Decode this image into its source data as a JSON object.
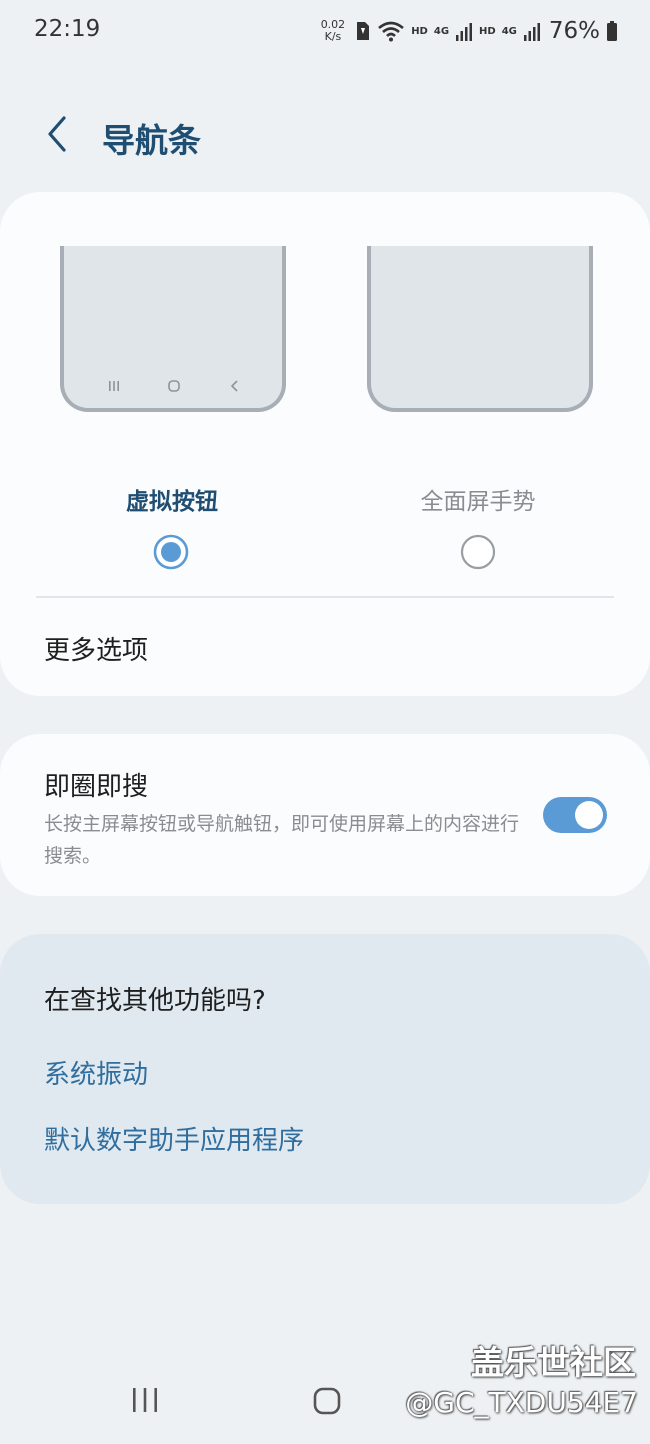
{
  "status_bar": {
    "time": "22:19",
    "speed_value": "0.02",
    "speed_unit": "K/s",
    "hd_1": "HD",
    "net_1": "4G",
    "hd_2": "HD",
    "net_2": "4G",
    "battery": "76%",
    "icons": [
      "sim-icon",
      "wifi-icon",
      "signal-icon",
      "battery-icon"
    ]
  },
  "header": {
    "title": "导航条",
    "back_icon": "chevron-left-icon"
  },
  "navigation_type": {
    "options": [
      {
        "label": "虚拟按钮",
        "selected": true
      },
      {
        "label": "全面屏手势",
        "selected": false
      }
    ],
    "more_options": "更多选项"
  },
  "circle_to_search": {
    "title": "即圈即搜",
    "description": "长按主屏幕按钮或导航触钮，即可使用屏幕上的内容进行搜索。",
    "enabled": true
  },
  "suggestions": {
    "title": "在查找其他功能吗?",
    "links": [
      "系统振动",
      "默认数字助手应用程序"
    ]
  },
  "watermark": {
    "line1": "盖乐世社区",
    "line2": "@GC_TXDU54E7"
  },
  "colors": {
    "accent": "#5b9bd5",
    "title": "#1f4e72",
    "link": "#2f6e9e",
    "background": "#edf1f4"
  }
}
